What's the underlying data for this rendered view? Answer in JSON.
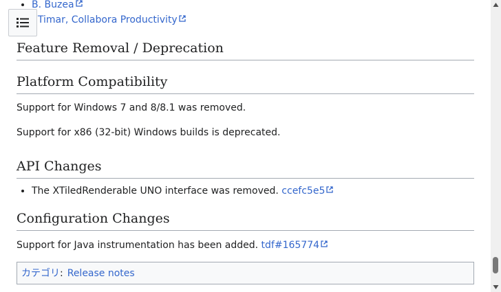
{
  "references": [
    {
      "prefix": "",
      "link": "B. Buzea"
    },
    {
      "prefix": "",
      "link": ". Timar, Collabora Productivity"
    }
  ],
  "sections": {
    "removal": {
      "heading": "Feature Removal / Deprecation"
    },
    "platform": {
      "heading": "Platform Compatibility",
      "paragraphs": [
        "Support for Windows 7 and 8/8.1 was removed.",
        "Support for x86 (32-bit) Windows builds is deprecated."
      ]
    },
    "api": {
      "heading": "API Changes",
      "items": [
        {
          "text": "The XTiledRenderable UNO interface was removed. ",
          "link": "ccefc5e5"
        }
      ]
    },
    "config": {
      "heading": "Configuration Changes",
      "text": "Support for Java instrumentation has been added. ",
      "link": "tdf#165774"
    }
  },
  "categories": {
    "label": "カテゴリ",
    "separator": ":",
    "items": [
      "Release notes"
    ]
  },
  "colors": {
    "link": "#3366cc",
    "text": "#202122",
    "border": "#a2a9b1"
  },
  "icons": {
    "toc": "list-icon",
    "external": "external-link-icon"
  }
}
